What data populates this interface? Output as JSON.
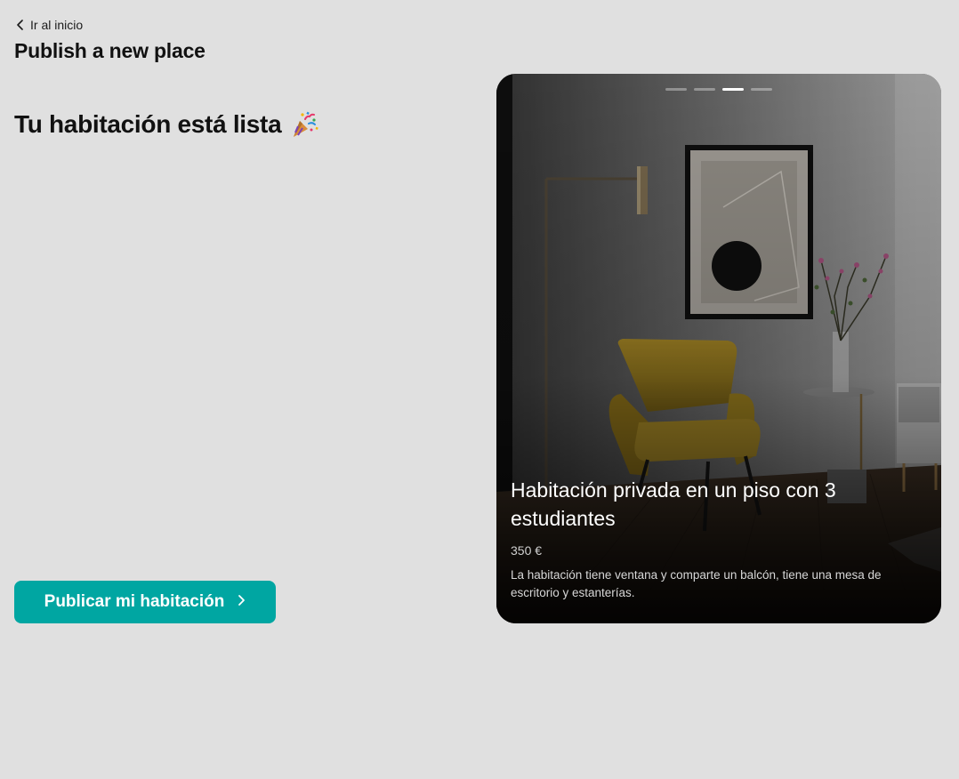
{
  "nav": {
    "back_label": "Ir al inicio",
    "back_icon": "chevron-left-icon"
  },
  "header": {
    "title": "Publish a new place"
  },
  "main": {
    "heading": "Tu habitación está lista",
    "heading_icon": "party-popper-icon",
    "publish_button_label": "Publicar mi habitación",
    "publish_button_icon": "chevron-right-icon"
  },
  "preview_card": {
    "title": "Habitación privada en un piso con 3 estudiantes",
    "price": "350 €",
    "description": "La habitación tiene ventana y comparte un balcón, tiene una mesa de escritorio y estanterías.",
    "carousel": {
      "total_slides": 4,
      "active_slide": 3
    }
  },
  "colors": {
    "background": "#e0e0e0",
    "accent": "#00a6a2",
    "text": "#111111",
    "card_text": "#ffffff"
  }
}
